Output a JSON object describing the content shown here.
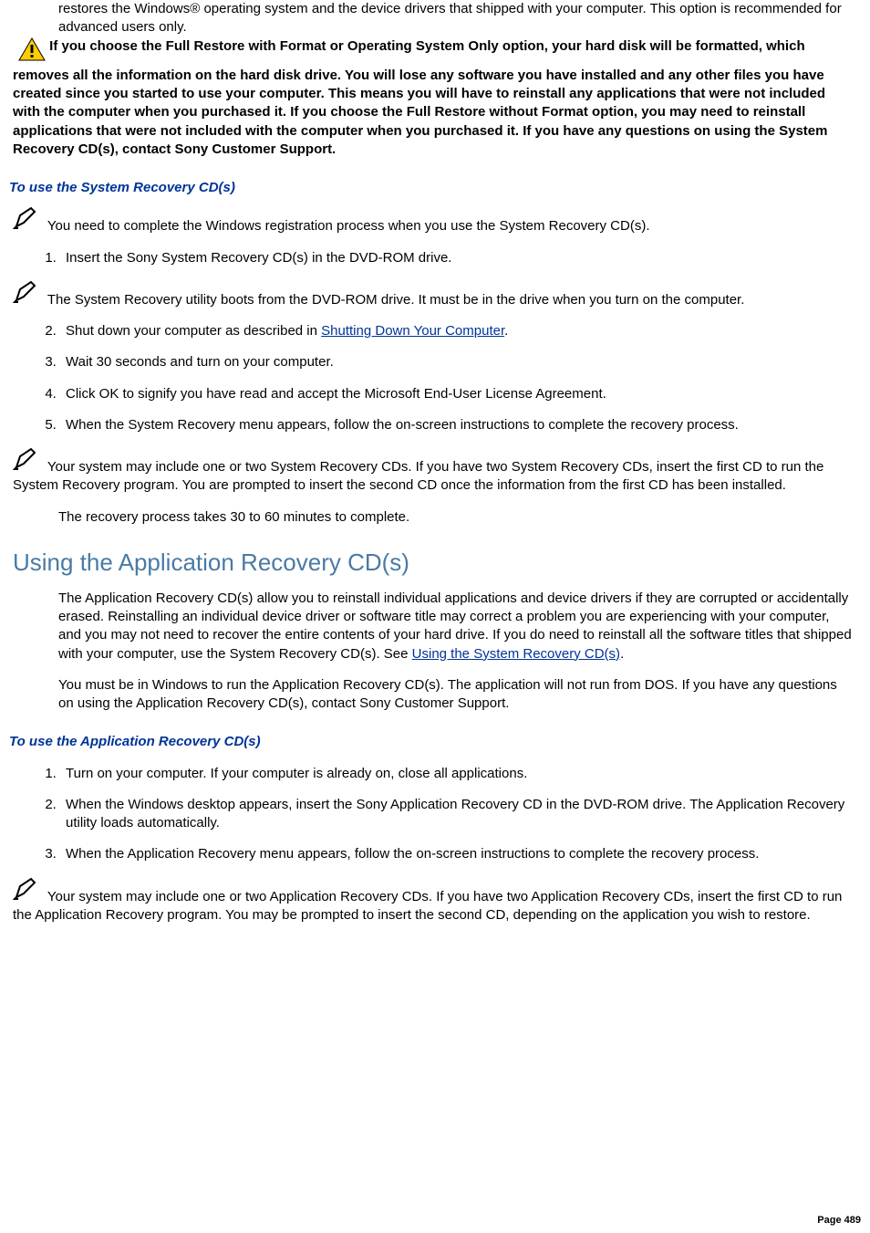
{
  "intro": "restores the Windows® operating system and the device drivers that shipped with your computer. This option is recommended for advanced users only.",
  "warning": " If you choose the Full Restore with Format or Operating System Only option, your hard disk will be formatted, which removes all the information on the hard disk drive. You will lose any software you have installed and any other files you have created since you started to use your computer. This means you will have to reinstall any applications that were not included with the computer when you purchased it. If you choose the Full Restore without Format option, you may need to reinstall applications that were not included with the computer when you purchased it. If you have any questions on using the System Recovery CD(s), contact Sony Customer Support.",
  "sec1_head": "To use the System Recovery CD(s)",
  "note1": " You need to complete the Windows registration process when you use the System Recovery CD(s).",
  "step1": "Insert the Sony System Recovery CD(s) in the DVD-ROM drive.",
  "note2": " The System Recovery utility boots from the DVD-ROM drive. It must be in the drive when you turn on the computer.",
  "step2a": "Shut down your computer as described in ",
  "step2link": "Shutting Down Your Computer",
  "step2b": ".",
  "step3": "Wait 30 seconds and turn on your computer.",
  "step4": "Click OK to signify you have read and accept the Microsoft End-User License Agreement.",
  "step5": "When the System Recovery menu appears, follow the on-screen instructions to complete the recovery process.",
  "note3": " Your system may include one or two System Recovery CDs. If you have two System Recovery CDs, insert the first CD to run the System Recovery program. You are prompted to insert the second CD once the information from the first CD has been installed.",
  "note3b": "The recovery process takes 30 to 60 minutes to complete.",
  "h2": "Using the Application Recovery CD(s)",
  "para1a": "The Application Recovery CD(s) allow you to reinstall individual applications and device drivers if they are corrupted or accidentally erased. Reinstalling an individual device driver or software title may correct a problem you are experiencing with your computer, and you may not need to recover the entire contents of your hard drive. If you do need to reinstall all the software titles that shipped with your computer, use the System Recovery CD(s). See ",
  "para1link": "Using the System Recovery CD(s)",
  "para1b": ".",
  "para2": "You must be in Windows to run the Application Recovery CD(s). The application will not run from DOS. If you have any questions on using the Application Recovery CD(s), contact Sony Customer Support.",
  "sec2_head": "To use the Application Recovery CD(s)",
  "astep1": "Turn on your computer. If your computer is already on, close all applications.",
  "astep2": "When the Windows desktop appears, insert the Sony Application Recovery CD in the DVD-ROM drive. The Application Recovery utility loads automatically.",
  "astep3": "When the Application Recovery menu appears, follow the on-screen instructions to complete the recovery process.",
  "note4": " Your system may include one or two Application Recovery CDs. If you have two Application Recovery CDs, insert the first CD to run the Application Recovery program. You may be prompted to insert the second CD, depending on the application you wish to restore.",
  "page": "Page 489"
}
